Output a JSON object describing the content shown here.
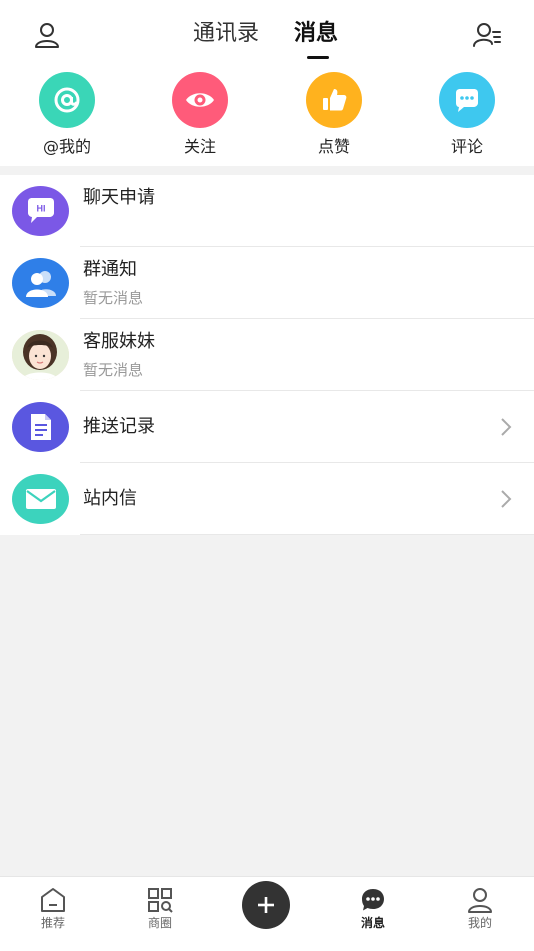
{
  "header": {
    "tabs": [
      {
        "label": "通讯录",
        "active": false
      },
      {
        "label": "消息",
        "active": true
      }
    ],
    "left_icon": "profile-icon",
    "right_icon": "contacts-settings-icon"
  },
  "quick_actions": [
    {
      "label": "@我的",
      "icon": "at-icon",
      "color": "#3ad6b7"
    },
    {
      "label": "关注",
      "icon": "eye-icon",
      "color": "#ff5b7a"
    },
    {
      "label": "点赞",
      "icon": "thumbs-up-icon",
      "color": "#ffb21e"
    },
    {
      "label": "评论",
      "icon": "comment-icon",
      "color": "#3ec8ef"
    }
  ],
  "messages": [
    {
      "title": "聊天申请",
      "subtitle": "",
      "icon": "chat-hi-icon",
      "color": "#7b58e6",
      "has_arrow": false
    },
    {
      "title": "群通知",
      "subtitle": "暂无消息",
      "icon": "group-icon",
      "color": "#2f7fe8",
      "has_arrow": false
    },
    {
      "title": "客服妹妹",
      "subtitle": "暂无消息",
      "icon": "customer-service-avatar",
      "color": "#f3d9c8",
      "has_arrow": false
    },
    {
      "title": "推送记录",
      "subtitle": "",
      "icon": "document-icon",
      "color": "#5a57e0",
      "has_arrow": true
    },
    {
      "title": "站内信",
      "subtitle": "",
      "icon": "mail-icon",
      "color": "#3cd3bd",
      "has_arrow": true
    }
  ],
  "tabbar": {
    "items": [
      {
        "label": "推荐",
        "icon": "home-icon",
        "active": false
      },
      {
        "label": "商圈",
        "icon": "grid-icon",
        "active": false
      },
      {
        "label": "",
        "icon": "plus-icon",
        "active": false
      },
      {
        "label": "消息",
        "icon": "message-icon",
        "active": true
      },
      {
        "label": "我的",
        "icon": "user-icon",
        "active": false
      }
    ]
  }
}
